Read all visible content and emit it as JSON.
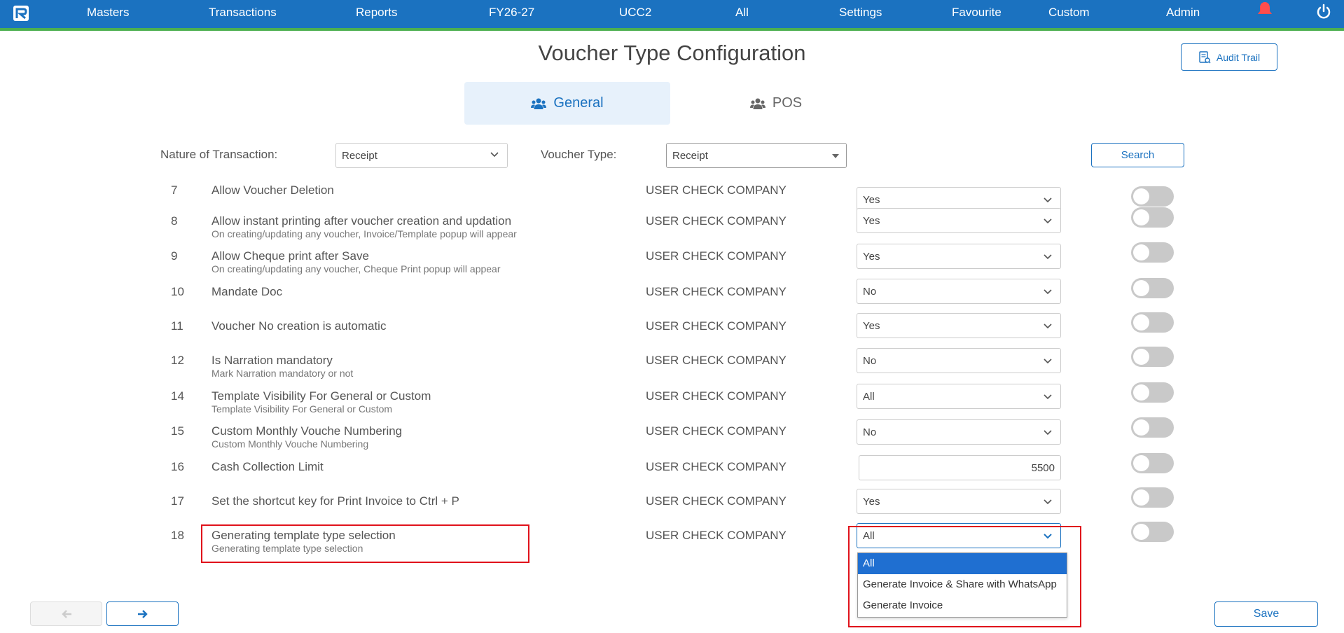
{
  "nav": {
    "items": [
      "Masters",
      "Transactions",
      "Reports",
      "FY26-27",
      "UCC2",
      "All",
      "Settings",
      "Favourite",
      "Custom",
      "Admin"
    ]
  },
  "icons": {
    "logo": "app-logo-icon",
    "bell": "bell-icon",
    "power": "power-icon",
    "audit": "audit-document-icon",
    "users": "users-icon",
    "chevron": "chevron-down-icon",
    "arrow_left": "arrow-left-icon",
    "arrow_right": "arrow-right-icon"
  },
  "colors": {
    "primary": "#1b72c0",
    "accent_line": "#4caf50",
    "bell": "#ff4d4d",
    "highlight": "#e0121b",
    "selected_option": "#1f6fd1"
  },
  "page": {
    "title": "Voucher Type Configuration",
    "audit_trail_label": "Audit Trail"
  },
  "tabs": {
    "general": "General",
    "pos": "POS"
  },
  "filters": {
    "nature_label": "Nature of Transaction:",
    "nature_value": "Receipt",
    "voucher_type_label": "Voucher Type:",
    "voucher_type_value": "Receipt",
    "search_label": "Search"
  },
  "rows": [
    {
      "num": "7",
      "title": "Allow Voucher Deletion",
      "subtitle": "",
      "company": "USER CHECK COMPANY",
      "value": "Yes",
      "kind": "select"
    },
    {
      "num": "8",
      "title": "Allow instant printing after voucher creation and updation",
      "subtitle": "On creating/updating any voucher, Invoice/Template popup will appear",
      "company": "USER CHECK COMPANY",
      "value": "Yes",
      "kind": "select"
    },
    {
      "num": "9",
      "title": "Allow Cheque print after Save",
      "subtitle": "On creating/updating any voucher, Cheque Print popup will appear",
      "company": "USER CHECK COMPANY",
      "value": "Yes",
      "kind": "select"
    },
    {
      "num": "10",
      "title": "Mandate Doc",
      "subtitle": "",
      "company": "USER CHECK COMPANY",
      "value": "No",
      "kind": "select"
    },
    {
      "num": "11",
      "title": "Voucher No creation is automatic",
      "subtitle": "",
      "company": "USER CHECK COMPANY",
      "value": "Yes",
      "kind": "select"
    },
    {
      "num": "12",
      "title": "Is Narration mandatory",
      "subtitle": "Mark Narration mandatory or not",
      "company": "USER CHECK COMPANY",
      "value": "No",
      "kind": "select"
    },
    {
      "num": "14",
      "title": "Template Visibility For General or Custom",
      "subtitle": "Template Visibility For General or Custom",
      "company": "USER CHECK COMPANY",
      "value": "All",
      "kind": "select"
    },
    {
      "num": "15",
      "title": "Custom Monthly Vouche Numbering",
      "subtitle": "Custom Monthly Vouche Numbering",
      "company": "USER CHECK COMPANY",
      "value": "No",
      "kind": "select"
    },
    {
      "num": "16",
      "title": "Cash Collection Limit",
      "subtitle": "",
      "company": "USER CHECK COMPANY",
      "value": "5500",
      "kind": "input"
    },
    {
      "num": "17",
      "title": "Set the shortcut key for Print Invoice to Ctrl + P",
      "subtitle": "",
      "company": "USER CHECK COMPANY",
      "value": "Yes",
      "kind": "select"
    },
    {
      "num": "18",
      "title": "Generating template type selection",
      "subtitle": "Generating template type selection",
      "company": "USER CHECK COMPANY",
      "value": "All",
      "kind": "select"
    }
  ],
  "dropdown": {
    "options": [
      "All",
      "Generate Invoice & Share with WhatsApp",
      "Generate Invoice"
    ],
    "selected": "All"
  },
  "footer": {
    "save_label": "Save"
  }
}
